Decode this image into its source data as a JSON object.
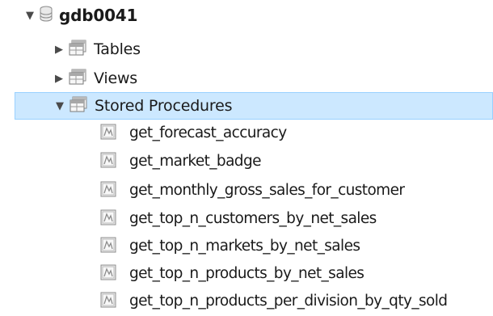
{
  "schema": {
    "name": "gdb0041",
    "expanded": true,
    "icon": "database-icon"
  },
  "folders": [
    {
      "label": "Tables",
      "expanded": false,
      "icon": "folder-table-icon"
    },
    {
      "label": "Views",
      "expanded": false,
      "icon": "folder-table-icon"
    },
    {
      "label": "Stored Procedures",
      "expanded": true,
      "selected": true,
      "icon": "folder-table-icon"
    }
  ],
  "procedures": [
    "get_forecast_accuracy",
    "get_market_badge",
    "get_monthly_gross_sales_for_customer",
    "get_top_n_customers_by_net_sales",
    "get_top_n_markets_by_net_sales",
    "get_top_n_products_by_net_sales",
    "get_top_n_products_per_division_by_qty_sold"
  ],
  "colors": {
    "selection_bg": "#cce8ff",
    "selection_border": "#99d1ff"
  }
}
